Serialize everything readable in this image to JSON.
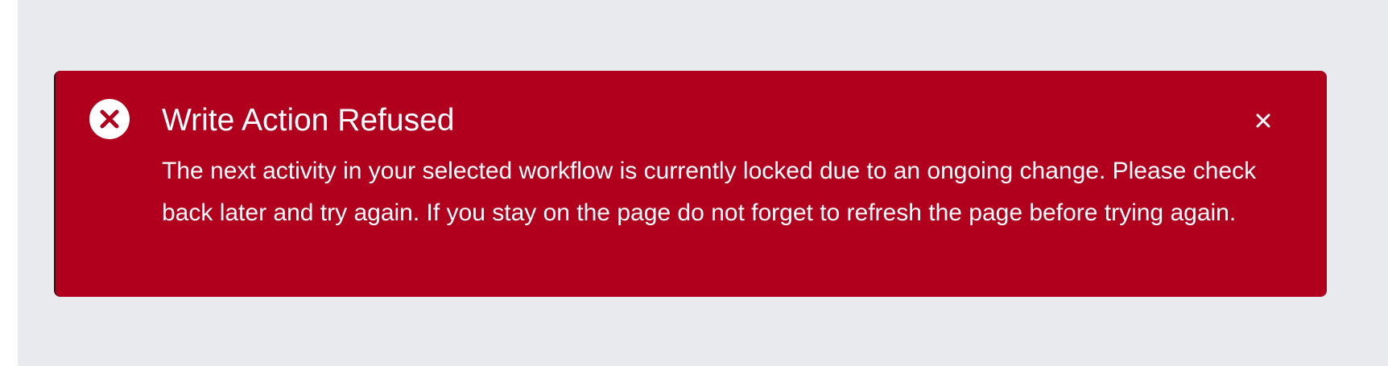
{
  "alert": {
    "title": "Write Action Refused",
    "message": "The next activity in your selected workflow is currently locked due to an ongoing change. Please check back later and try again. If you stay on the page do not forget to refresh the page before trying again.",
    "status_icon": "error-circle-x-icon",
    "close_icon": "close-icon",
    "colors": {
      "background": "#b0001e",
      "text": "#ffffff",
      "page_background": "#e9eaee"
    }
  }
}
